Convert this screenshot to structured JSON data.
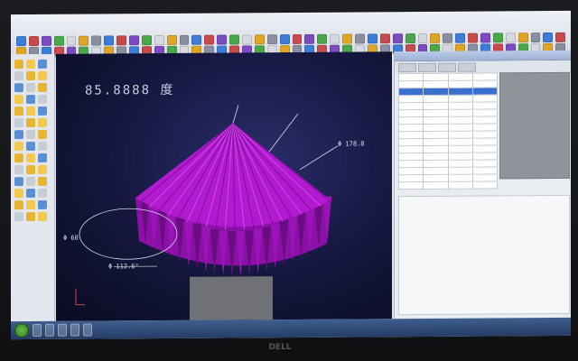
{
  "viewport": {
    "readout": "85.8888 度",
    "dim_right": "Φ 178.8",
    "dim_left": "Φ 60",
    "dim_bottom": "Φ 112.6°"
  },
  "panel": {
    "table_rows": [
      [
        "",
        "",
        "",
        ""
      ],
      [
        "",
        "",
        "",
        ""
      ],
      [
        "",
        "",
        "",
        ""
      ],
      [
        "",
        "",
        "",
        ""
      ]
    ],
    "lower_tabs": [
      "",
      ""
    ]
  },
  "taskbar": {
    "buttons": [
      "",
      "",
      "",
      "",
      ""
    ],
    "clock_time": "",
    "clock_date": ""
  },
  "monitor": {
    "brand": "DELL"
  },
  "colors": {
    "model": "#b21ad0",
    "model_dark": "#7a0f93",
    "viewport_bg": "#14163c"
  }
}
